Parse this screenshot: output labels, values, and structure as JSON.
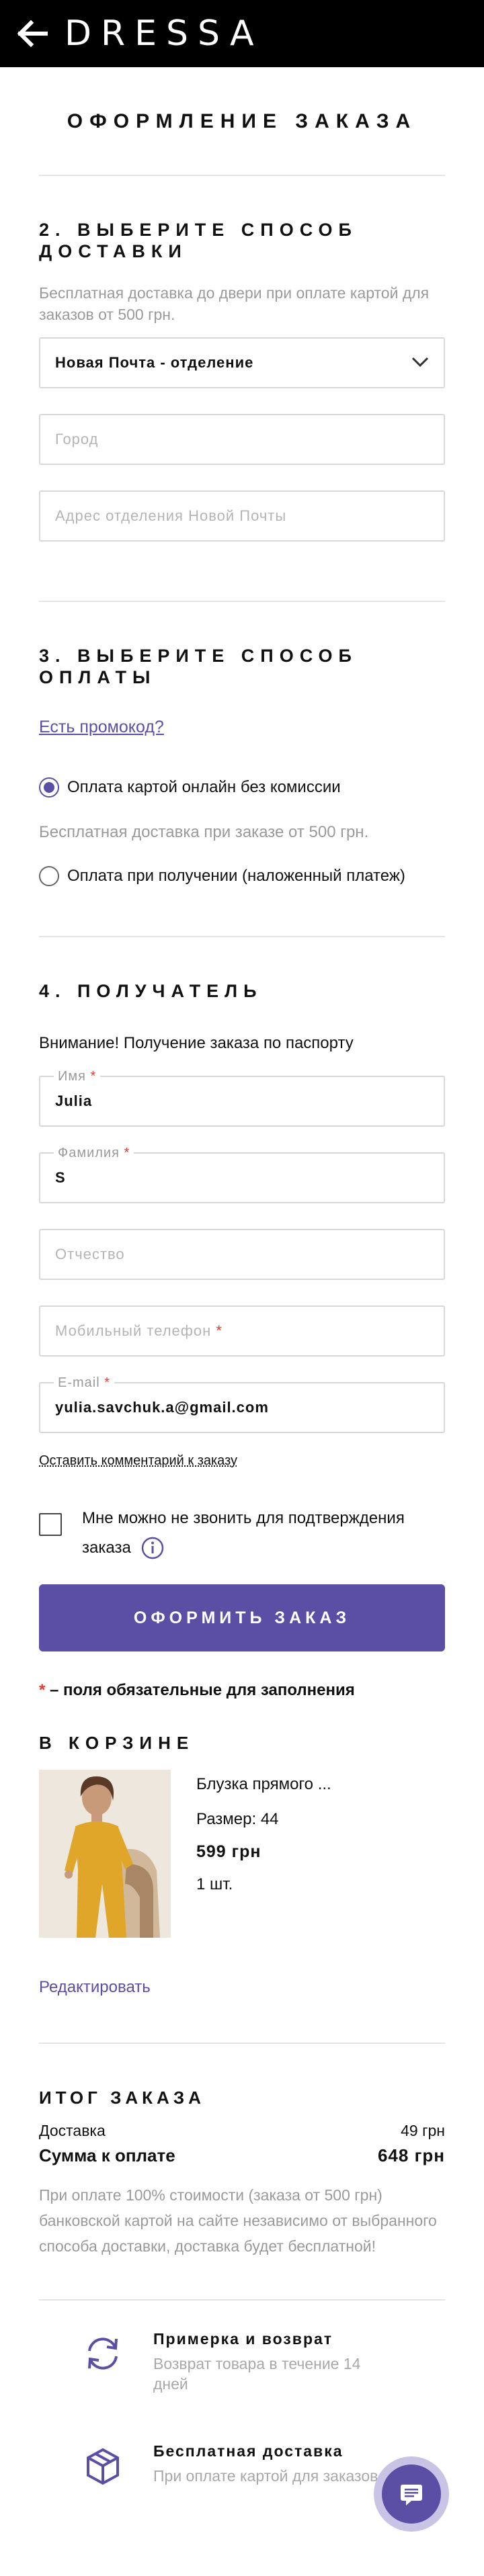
{
  "header": {
    "logo": "DRESSA"
  },
  "page_title": "ОФОРМЛЕНИЕ ЗАКАЗА",
  "delivery": {
    "title": "2. ВЫБЕРИТЕ СПОСОБ ДОСТАВКИ",
    "note": "Бесплатная доставка до двери при оплате картой для заказов от 500 грн.",
    "method_selected": "Новая Почта - отделение",
    "city_placeholder": "Город",
    "address_placeholder": "Адрес отделения Новой Почты"
  },
  "payment": {
    "title": "3. ВЫБЕРИТЕ СПОСОБ ОПЛАТЫ",
    "promo_link": "Есть промокод?",
    "option_card": "Оплата картой онлайн без комиссии",
    "option_card_note": "Бесплатная доставка при заказе от 500 грн.",
    "option_cod": "Оплата при получении (наложенный платеж)"
  },
  "recipient": {
    "title": "4. ПОЛУЧАТЕЛЬ",
    "notice": "Внимание! Получение заказа по паспорту",
    "first_name_label": "Имя",
    "first_name_value": "Julia",
    "last_name_label": "Фамилия",
    "last_name_value": "S",
    "patronymic_placeholder": "Отчество",
    "phone_placeholder": "Мобильный телефон",
    "email_label": "E-mail",
    "email_value": "yulia.savchuk.a@gmail.com",
    "comment_link": "Оставить комментарий к заказу",
    "no_call_label_1": "Мне можно не звонить для подтверждения",
    "no_call_label_2": "заказа"
  },
  "submit_label": "ОФОРМИТЬ ЗАКАЗ",
  "required_note": "– поля обязательные для заполнения",
  "cart": {
    "title": "В КОРЗИНЕ",
    "item": {
      "name": "Блузка прямого ...",
      "size": "Размер: 44",
      "price": "599 грн",
      "qty": "1 шт."
    },
    "edit_link": "Редактировать"
  },
  "summary": {
    "title": "ИТОГ ЗАКАЗА",
    "delivery_label": "Доставка",
    "delivery_value": "49 грн",
    "total_label": "Сумма к оплате",
    "total_value": "648 грн",
    "note": "При оплате 100% стоимости (заказа от 500 грн) банковской картой на сайте независимо от выбранного способа доставки, доставка будет бесплатной!"
  },
  "features": [
    {
      "title": "Примерка и возврат",
      "desc": "Возврат товара в течение 14 дней",
      "icon": "refresh-icon"
    },
    {
      "title": "Бесплатная доставка",
      "desc": "При оплате картой для заказов",
      "icon": "box-icon"
    }
  ],
  "colors": {
    "accent": "#5b4fa5",
    "required": "#e53935"
  }
}
